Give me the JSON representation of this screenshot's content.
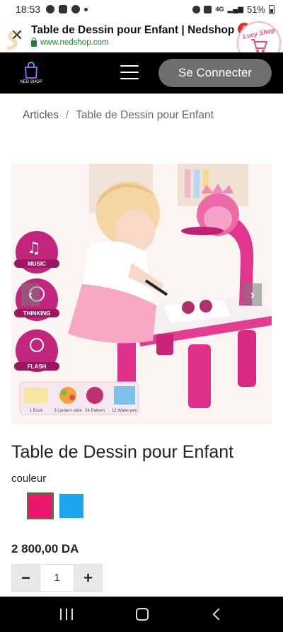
{
  "status_bar": {
    "time": "18:53",
    "network": "4G",
    "battery": "51%"
  },
  "tab": {
    "title": "Table de Dessin pour Enfant | Nedshop",
    "url": "www.nedshop.com",
    "badge_count": "1",
    "badge_brand": "Lucy Shop"
  },
  "header": {
    "logo_text": "NED SHOP",
    "login_label": "Se Connecter"
  },
  "breadcrumb": {
    "items": [
      "Articles",
      "Table de Dessin pour Enfant"
    ],
    "separator": "/"
  },
  "product": {
    "image_labels": {
      "music": "MUSIC",
      "thinking": "THINKING",
      "flash": "FLASH",
      "book": "1 Book",
      "lantern": "3 Lantern slide",
      "pattern": "24 Pattern",
      "pen": "12 Water pen"
    },
    "title": "Table de Dessin pour Enfant",
    "variant_label": "couleur",
    "swatches": [
      {
        "name": "pink",
        "color": "#e8196c",
        "selected": true
      },
      {
        "name": "blue",
        "color": "#1aa6ee",
        "selected": false
      }
    ],
    "price": "2 800,00 DA",
    "quantity": "1",
    "qty_minus": "−",
    "qty_plus": "+"
  },
  "colors": {
    "header_bg": "#000000",
    "login_button": "#6f6f6f",
    "url_green": "#1a7f37"
  }
}
